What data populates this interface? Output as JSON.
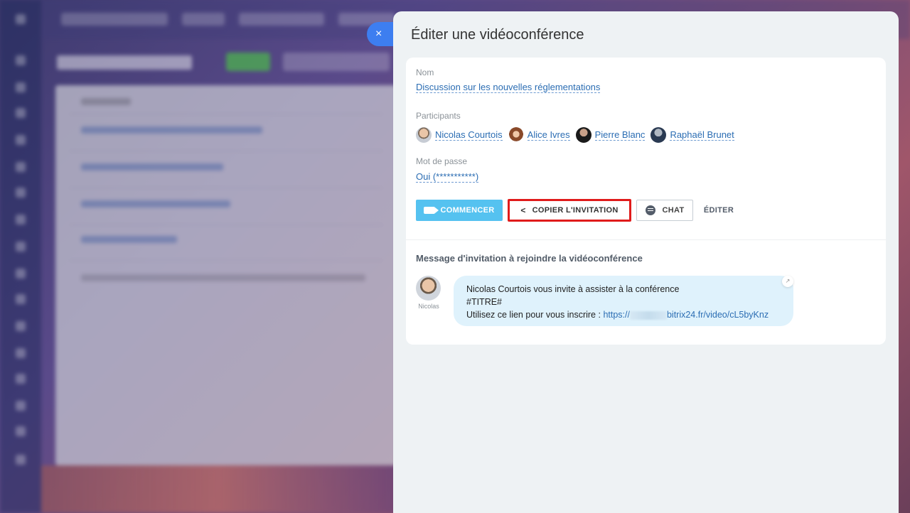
{
  "close_label": "×",
  "slider": {
    "title": "Éditer une vidéoconférence"
  },
  "form": {
    "name_label": "Nom",
    "name_value": "Discussion sur les nouvelles réglementations",
    "participants_label": "Participants",
    "participants": [
      {
        "name": "Nicolas Courtois",
        "avatar": "nicolas-avatar"
      },
      {
        "name": "Alice Ivres",
        "avatar": "alice-avatar"
      },
      {
        "name": "Pierre Blanc",
        "avatar": "pierre-avatar"
      },
      {
        "name": "Raphaël Brunet",
        "avatar": "raphael-avatar"
      }
    ],
    "password_label": "Mot de passe",
    "password_value": "Oui (***********)"
  },
  "actions": {
    "start_label": "COMMENCER",
    "copy_label": "COPIER L'INVITATION",
    "chat_label": "CHAT",
    "edit_label": "ÉDITER"
  },
  "invitation": {
    "title": "Message d'invitation à rejoindre la vidéoconférence",
    "sender_name": "Nicolas",
    "line1": "Nicolas Courtois vous invite à assister à la conférence",
    "line2": "#TITRE#",
    "line3_prefix": "Utilisez ce lien pour vous inscrire : ",
    "link_start": "https://",
    "link_end": "bitrix24.fr/video/cL5byKnz",
    "expand_icon": "↗"
  },
  "colors": {
    "accent": "#3d7ef0",
    "start_button": "#55c2f0",
    "highlight_border": "#e01b1b",
    "link": "#2b6db3",
    "bubble": "#dff2fc"
  }
}
